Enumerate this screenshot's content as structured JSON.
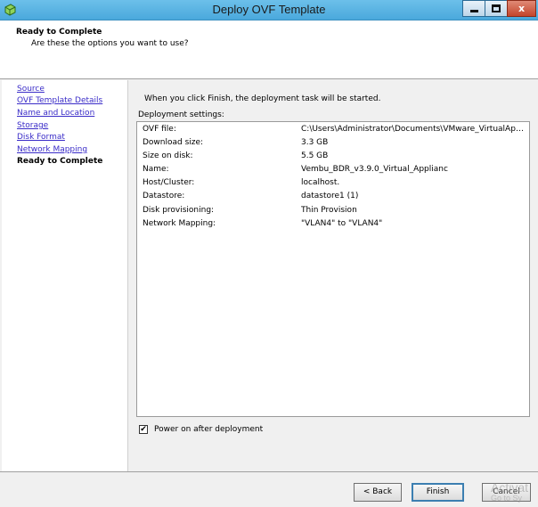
{
  "window": {
    "title": "Deploy OVF Template",
    "icon": "ovf-app-icon",
    "controls": {
      "minimize": "minimize-icon",
      "maximize": "maximize-icon",
      "close_label": "x"
    }
  },
  "header": {
    "title": "Ready to Complete",
    "subtitle": "Are these the options you want to use?"
  },
  "nav": {
    "items": [
      {
        "label": "Source",
        "type": "link"
      },
      {
        "label": "OVF Template Details",
        "type": "link"
      },
      {
        "label": "Name and Location",
        "type": "link"
      },
      {
        "label": "Storage",
        "type": "link"
      },
      {
        "label": "Disk Format",
        "type": "link"
      },
      {
        "label": "Network Mapping",
        "type": "link"
      },
      {
        "label": "Ready to Complete",
        "type": "current"
      }
    ]
  },
  "main": {
    "intro": "When you click Finish, the deployment task will be started.",
    "settings_label": "Deployment settings:",
    "settings": [
      {
        "key": "OVF file:",
        "value": "C:\\Users\\Administrator\\Documents\\VMware_VirtualApplia..."
      },
      {
        "key": "Download size:",
        "value": "3.3 GB"
      },
      {
        "key": "Size on disk:",
        "value": "5.5 GB"
      },
      {
        "key": "Name:",
        "value": "Vembu_BDR_v3.9.0_Virtual_Applianc"
      },
      {
        "key": "Host/Cluster:",
        "value": "localhost."
      },
      {
        "key": "Datastore:",
        "value": "datastore1 (1)"
      },
      {
        "key": "Disk provisioning:",
        "value": "Thin Provision"
      },
      {
        "key": "Network Mapping:",
        "value": "\"VLAN4\" to \"VLAN4\""
      }
    ],
    "power_on": {
      "label": "Power on after deployment",
      "checked": true,
      "check_glyph": "✔"
    }
  },
  "footer": {
    "back_label": "< Back",
    "finish_label": "Finish",
    "cancel_label": "Cancel"
  },
  "watermark": {
    "line1": "Activat",
    "line2": "Go to Sy"
  }
}
